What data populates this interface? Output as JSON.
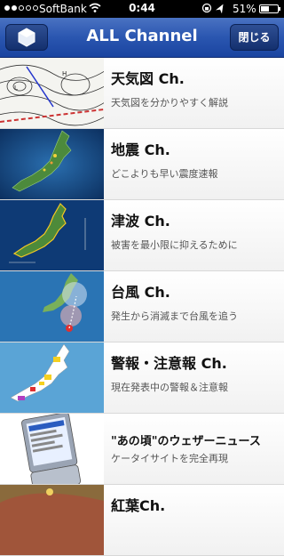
{
  "status_bar": {
    "carrier": "SoftBank",
    "time": "0:44",
    "battery": "51%",
    "battery_level": 0.51,
    "signal_bars": 2
  },
  "nav": {
    "title": "ALL Channel",
    "close_label": "閉じる"
  },
  "channels": [
    {
      "title": "天気図 Ch.",
      "subtitle": "天気図を分かりやすく解説",
      "thumb": "weather-map"
    },
    {
      "title": "地震 Ch.",
      "subtitle": "どこよりも早い震度速報",
      "thumb": "earthquake-map"
    },
    {
      "title": "津波 Ch.",
      "subtitle": "被害を最小限に抑えるために",
      "thumb": "tsunami-map"
    },
    {
      "title": "台風 Ch.",
      "subtitle": "発生から消滅まで台風を追う",
      "thumb": "typhoon-map"
    },
    {
      "title": "警報・注意報 Ch.",
      "subtitle": "現在発表中の警報＆注意報",
      "thumb": "warning-map"
    },
    {
      "title": "\"あの頃\"のウェザーニュース",
      "subtitle": "ケータイサイトを完全再現",
      "thumb": "feature-phone"
    },
    {
      "title": "紅葉Ch.",
      "subtitle": "",
      "thumb": "autumn-leaves"
    }
  ]
}
